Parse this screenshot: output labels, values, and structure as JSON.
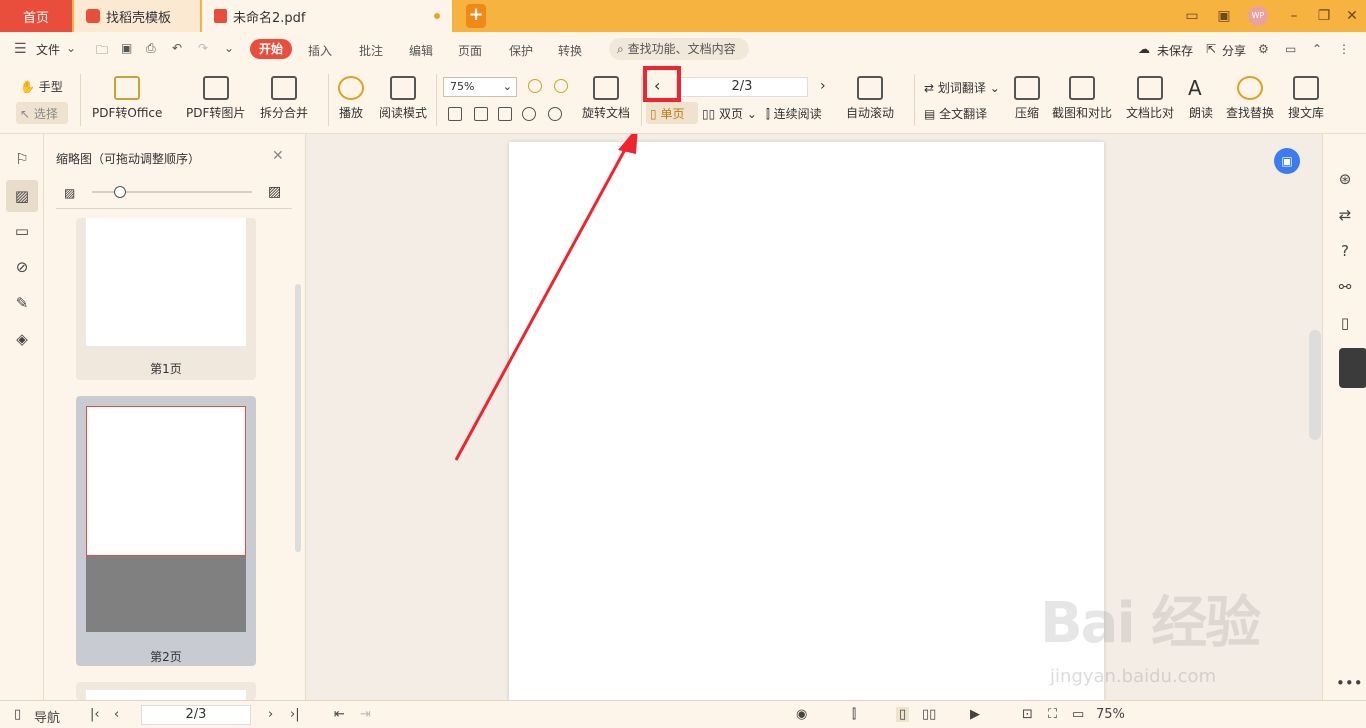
{
  "tabs": {
    "home": "首页",
    "template": "找稻壳模板",
    "document": "未命名2.pdf"
  },
  "menu": {
    "file": "文件",
    "start": "开始",
    "items": [
      "插入",
      "批注",
      "编辑",
      "页面",
      "保护",
      "转换"
    ],
    "search_placeholder": "查找功能、文档内容",
    "unsaved": "未保存",
    "share": "分享"
  },
  "toolbar": {
    "hand": "手型",
    "select": "选择",
    "pdf_to_office": "PDF转Office",
    "pdf_to_image": "PDF转图片",
    "split_merge": "拆分合并",
    "play": "播放",
    "read_mode": "阅读模式",
    "zoom": "75%",
    "rotate_doc": "旋转文档",
    "page_value": "2/3",
    "single_page": "单页",
    "double_page": "双页",
    "continuous": "连续阅读",
    "auto_scroll": "自动滚动",
    "word_translate": "划词翻译",
    "full_translate": "全文翻译",
    "compress": "压缩",
    "screenshot_compare": "截图和对比",
    "doc_compare": "文档比对",
    "read_aloud": "朗读",
    "find_replace": "查找替换",
    "search_library": "搜文库"
  },
  "thumbnails": {
    "title": "缩略图（可拖动调整顺序）",
    "pages": [
      "第1页",
      "第2页"
    ]
  },
  "status": {
    "nav": "导航",
    "page_value": "2/3",
    "zoom": "75%"
  },
  "watermark": {
    "main": "Bai 经验",
    "url": "jingyan.baidu.com"
  },
  "colors": {
    "accent": "#e94e3d",
    "titlebar": "#f7b33f",
    "highlight": "#f0242e"
  }
}
